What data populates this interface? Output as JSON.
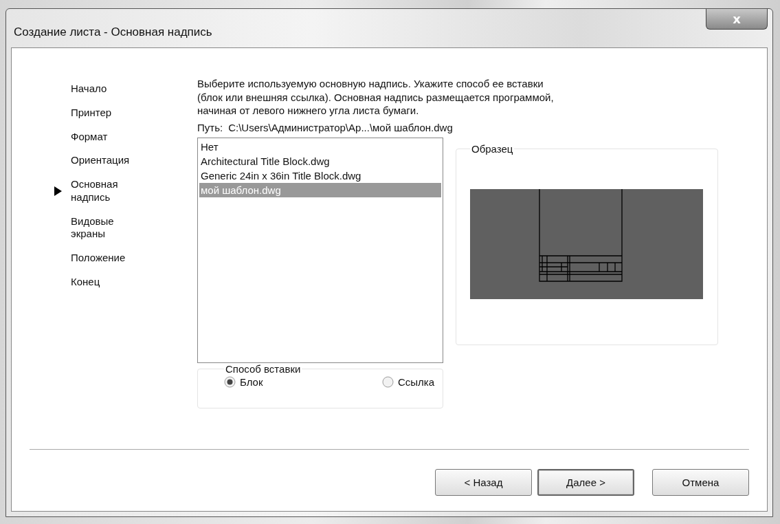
{
  "window": {
    "title": "Создание листа - Основная надпись",
    "close_label": "x"
  },
  "steps": [
    {
      "label": "Начало",
      "selected": false
    },
    {
      "label": "Принтер",
      "selected": false
    },
    {
      "label": "Формат",
      "selected": false
    },
    {
      "label": "Ориентация",
      "selected": false
    },
    {
      "label": "Основная надпись",
      "selected": true
    },
    {
      "label": "Видовые экраны",
      "selected": false
    },
    {
      "label": "Положение",
      "selected": false
    },
    {
      "label": "Конец",
      "selected": false
    }
  ],
  "instruction": {
    "text": "Выберите используемую основную надпись. Укажите способ ее вставки (блок или внешняя ссылка). Основная надпись размещается программой, начиная от левого нижнего угла листа бумаги."
  },
  "path": {
    "label": "Путь:",
    "value": "C:\\Users\\Администратор\\Ap...\\мой шаблон.dwg"
  },
  "title_blocks": [
    {
      "label": "Нет",
      "selected": false
    },
    {
      "label": "Architectural Title Block.dwg",
      "selected": false
    },
    {
      "label": "Generic 24in x 36in Title Block.dwg",
      "selected": false
    },
    {
      "label": "мой шаблон.dwg",
      "selected": true
    }
  ],
  "preview": {
    "title": "Образец"
  },
  "insert_method": {
    "title": "Способ вставки",
    "options": [
      {
        "label": "Блок",
        "selected": true
      },
      {
        "label": "Ссылка",
        "selected": false
      }
    ]
  },
  "buttons": [
    {
      "label": "< Назад",
      "default": false
    },
    {
      "label": "Далее >",
      "default": true
    },
    {
      "label": "Отмена",
      "default": false
    }
  ]
}
